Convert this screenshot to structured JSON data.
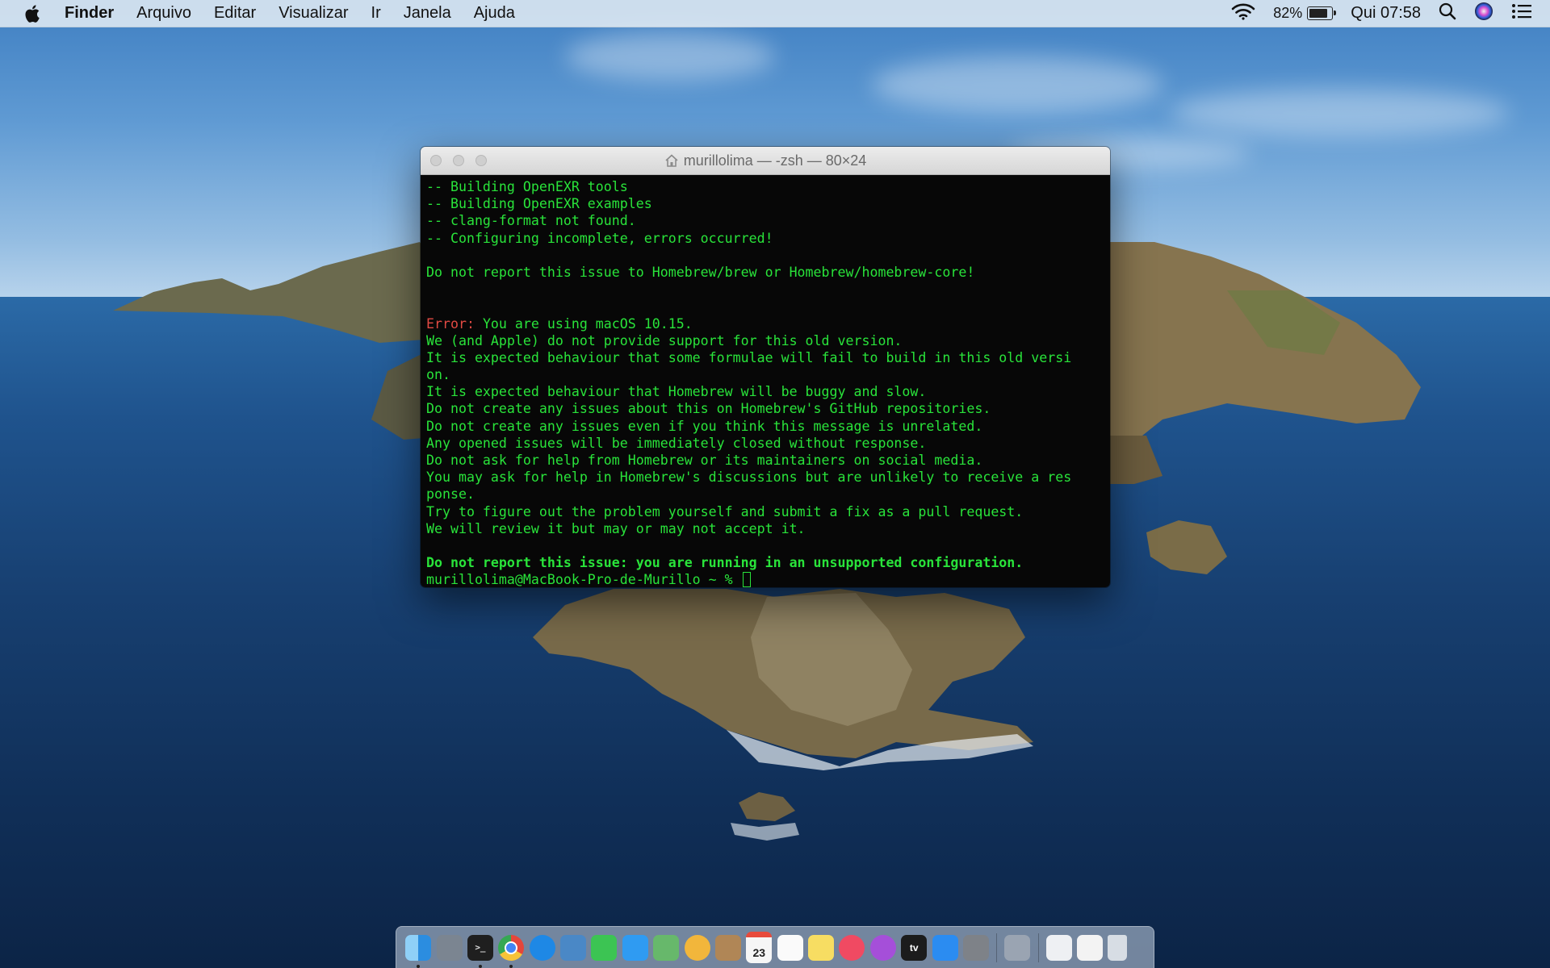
{
  "menubar": {
    "app_name": "Finder",
    "menus": [
      "Arquivo",
      "Editar",
      "Visualizar",
      "Ir",
      "Janela",
      "Ajuda"
    ],
    "battery_percent": "82%",
    "battery_level": 0.82,
    "clock": "Qui 07:58",
    "status_icons": [
      "wifi-icon",
      "battery-icon",
      "spotlight-search-icon",
      "siri-icon",
      "notification-center-icon"
    ]
  },
  "terminal": {
    "title": "murillolima — -zsh — 80×24",
    "lines": [
      {
        "text": "-- Building OpenEXR tools"
      },
      {
        "text": "-- Building OpenEXR examples"
      },
      {
        "text": "-- clang-format not found."
      },
      {
        "text": "-- Configuring incomplete, errors occurred!"
      },
      {
        "text": ""
      },
      {
        "text": "Do not report this issue to Homebrew/brew or Homebrew/homebrew-core!"
      },
      {
        "text": ""
      },
      {
        "text": ""
      },
      {
        "prefix": "Error:",
        "text": " You are using macOS 10.15."
      },
      {
        "text": "We (and Apple) do not provide support for this old version."
      },
      {
        "text": "It is expected behaviour that some formulae will fail to build in this old versi"
      },
      {
        "text": "on."
      },
      {
        "text": "It is expected behaviour that Homebrew will be buggy and slow."
      },
      {
        "text": "Do not create any issues about this on Homebrew's GitHub repositories."
      },
      {
        "text": "Do not create any issues even if you think this message is unrelated."
      },
      {
        "text": "Any opened issues will be immediately closed without response."
      },
      {
        "text": "Do not ask for help from Homebrew or its maintainers on social media."
      },
      {
        "text": "You may ask for help in Homebrew's discussions but are unlikely to receive a res"
      },
      {
        "text": "ponse."
      },
      {
        "text": "Try to figure out the problem yourself and submit a fix as a pull request."
      },
      {
        "text": "We will review it but may or may not accept it."
      },
      {
        "text": ""
      },
      {
        "text": "Do not report this issue: you are running in an unsupported configuration.",
        "bold": true
      },
      {
        "text": "murillolima@MacBook-Pro-de-Murillo ~ % ",
        "cursor": true
      }
    ],
    "colors": {
      "text": "#29e33a",
      "error": "#e24a43",
      "background": "#070707"
    }
  },
  "dock": {
    "apps": [
      {
        "name": "finder-icon",
        "color": "#2b8de0",
        "running": true
      },
      {
        "name": "launchpad-icon",
        "color": "#7b8591",
        "running": false
      },
      {
        "name": "terminal-icon",
        "color": "#1f1f1f",
        "running": true
      },
      {
        "name": "chrome-icon",
        "color": "#e5463a",
        "running": true
      },
      {
        "name": "safari-icon",
        "color": "#1e88e5",
        "running": false
      },
      {
        "name": "preview-icon",
        "color": "#4a88c6",
        "running": false
      },
      {
        "name": "facetime-icon",
        "color": "#3cc453",
        "running": false
      },
      {
        "name": "messages-icon",
        "color": "#2f9bf2",
        "running": false
      },
      {
        "name": "maps-icon",
        "color": "#67b86b",
        "running": false
      },
      {
        "name": "photos-icon",
        "color": "#f2b63b",
        "running": false
      },
      {
        "name": "contacts-icon",
        "color": "#b08656",
        "running": false
      },
      {
        "name": "calendar-icon",
        "color": "#f6f6f6",
        "running": false
      },
      {
        "name": "reminders-icon",
        "color": "#fafafa",
        "running": false
      },
      {
        "name": "notes-icon",
        "color": "#f7dd62",
        "running": false
      },
      {
        "name": "music-icon",
        "color": "#f04a62",
        "running": false
      },
      {
        "name": "podcasts-icon",
        "color": "#a54fd9",
        "running": false
      },
      {
        "name": "tv-icon",
        "color": "#1c1c1c",
        "running": false
      },
      {
        "name": "app-store-icon",
        "color": "#2b8cf1",
        "running": false
      },
      {
        "name": "system-preferences-icon",
        "color": "#7e8288",
        "running": false
      }
    ],
    "calendar_day": "23",
    "tv_label": "tv",
    "extras": [
      {
        "name": "utility-app-icon",
        "color": "#9aa4b2"
      },
      {
        "name": "document-icon",
        "color": "#eef0f3"
      },
      {
        "name": "certificate-icon",
        "color": "#f3f3f3"
      },
      {
        "name": "trash-icon",
        "color": "#d7dde4"
      }
    ]
  }
}
